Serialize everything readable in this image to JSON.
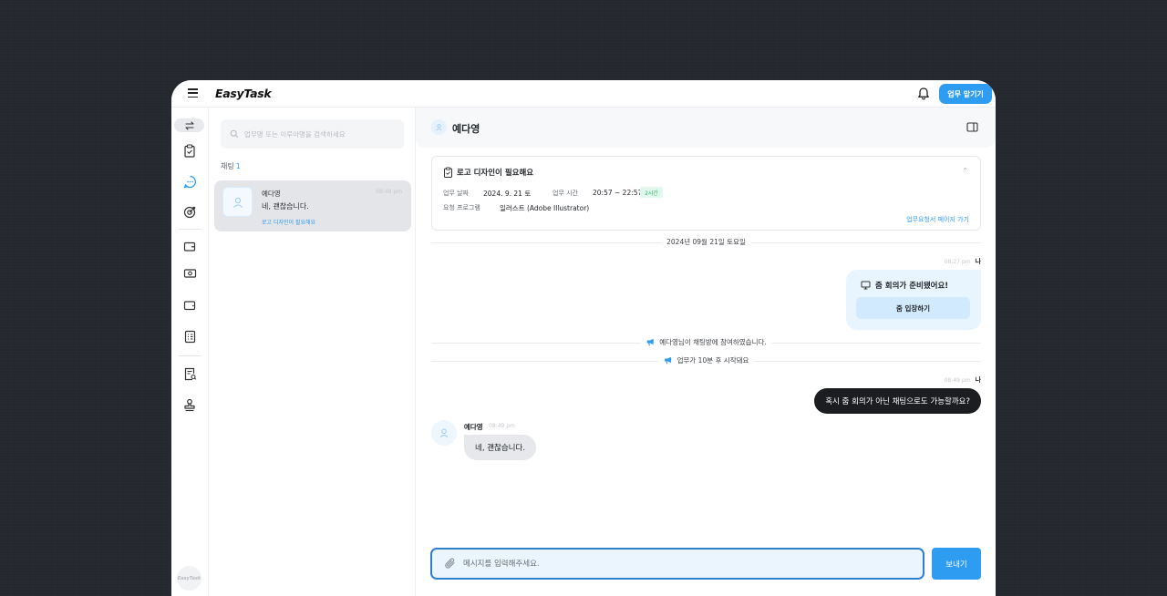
{
  "app": {
    "logo": "EasyTask"
  },
  "header": {
    "primary_button": "업무 맡기기"
  },
  "colors": {
    "accent": "#2e9cf0",
    "dark_bubble": "#1b1d21",
    "badge_green": "#2cba6a"
  },
  "sidebar": {
    "icons": [
      "swap-icon",
      "task-clipboard-icon",
      "chat-icon",
      "target-icon",
      "wallet-icon",
      "cash-icon",
      "card-icon",
      "checklist-icon",
      "document-search-icon",
      "stamp-icon"
    ],
    "avatar_text": "EasyTask"
  },
  "list": {
    "search_placeholder": "업무명 또는 이루아명을 검색하세요",
    "count_label": "채팅",
    "count_value": "1",
    "items": [
      {
        "name": "예다영",
        "time": "08:49 pm",
        "last_message": "네, 괜찮습니다.",
        "tag": "로고 디자인이 필요해요"
      }
    ]
  },
  "chat": {
    "partner_name": "예다영",
    "task": {
      "title": "로고 디자인이 필요해요",
      "date_label": "업무 날짜",
      "date_value": "2024. 9. 21 토",
      "time_label": "업무 시간",
      "time_value": "20:57 ~ 22:57",
      "duration_badge": "2시간",
      "program_label": "요청 프로그램",
      "program_value": "일러스트 (Adobe Illustrator)",
      "link": "업무요청서 페이지 가기"
    },
    "date_divider": "2024년 09월 21일 토요일",
    "messages": {
      "m1_time": "08:27 pm",
      "m1_sender": "나",
      "zoom_title": "줌 회의가 준비됐어요!",
      "zoom_button": "줌 입장하기",
      "system1": "예다영님이 채팅방에 참여하였습니다.",
      "system2": "업무가 10분 후 시작돼요",
      "m2_time": "08:49 pm",
      "m2_sender": "나",
      "m2_text": "혹시 줌 회의가 아닌 채팅으로도 가능할까요?",
      "m3_sender": "예다영",
      "m3_time": "08:49 pm",
      "m3_text": "네, 괜찮습니다."
    },
    "composer": {
      "placeholder": "메시지를 입력해주세요.",
      "send_label": "보내기"
    }
  }
}
